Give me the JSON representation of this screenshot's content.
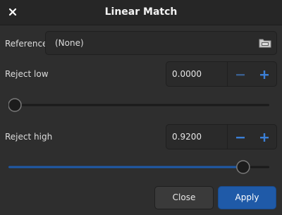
{
  "window": {
    "title": "Linear Match",
    "close_icon": "close-icon"
  },
  "reference": {
    "label": "Reference:",
    "value": "(None)",
    "browse_icon": "folder-icon"
  },
  "reject_low": {
    "label": "Reject low",
    "value": "0.0000",
    "slider_level": 0.0
  },
  "reject_high": {
    "label": "Reject high",
    "value": "0.9200",
    "slider_level": 0.92
  },
  "buttons": {
    "close_label": "Close",
    "apply_label": "Apply"
  },
  "colors": {
    "accent": "#1f5aa8",
    "background": "#2e2e2e"
  }
}
